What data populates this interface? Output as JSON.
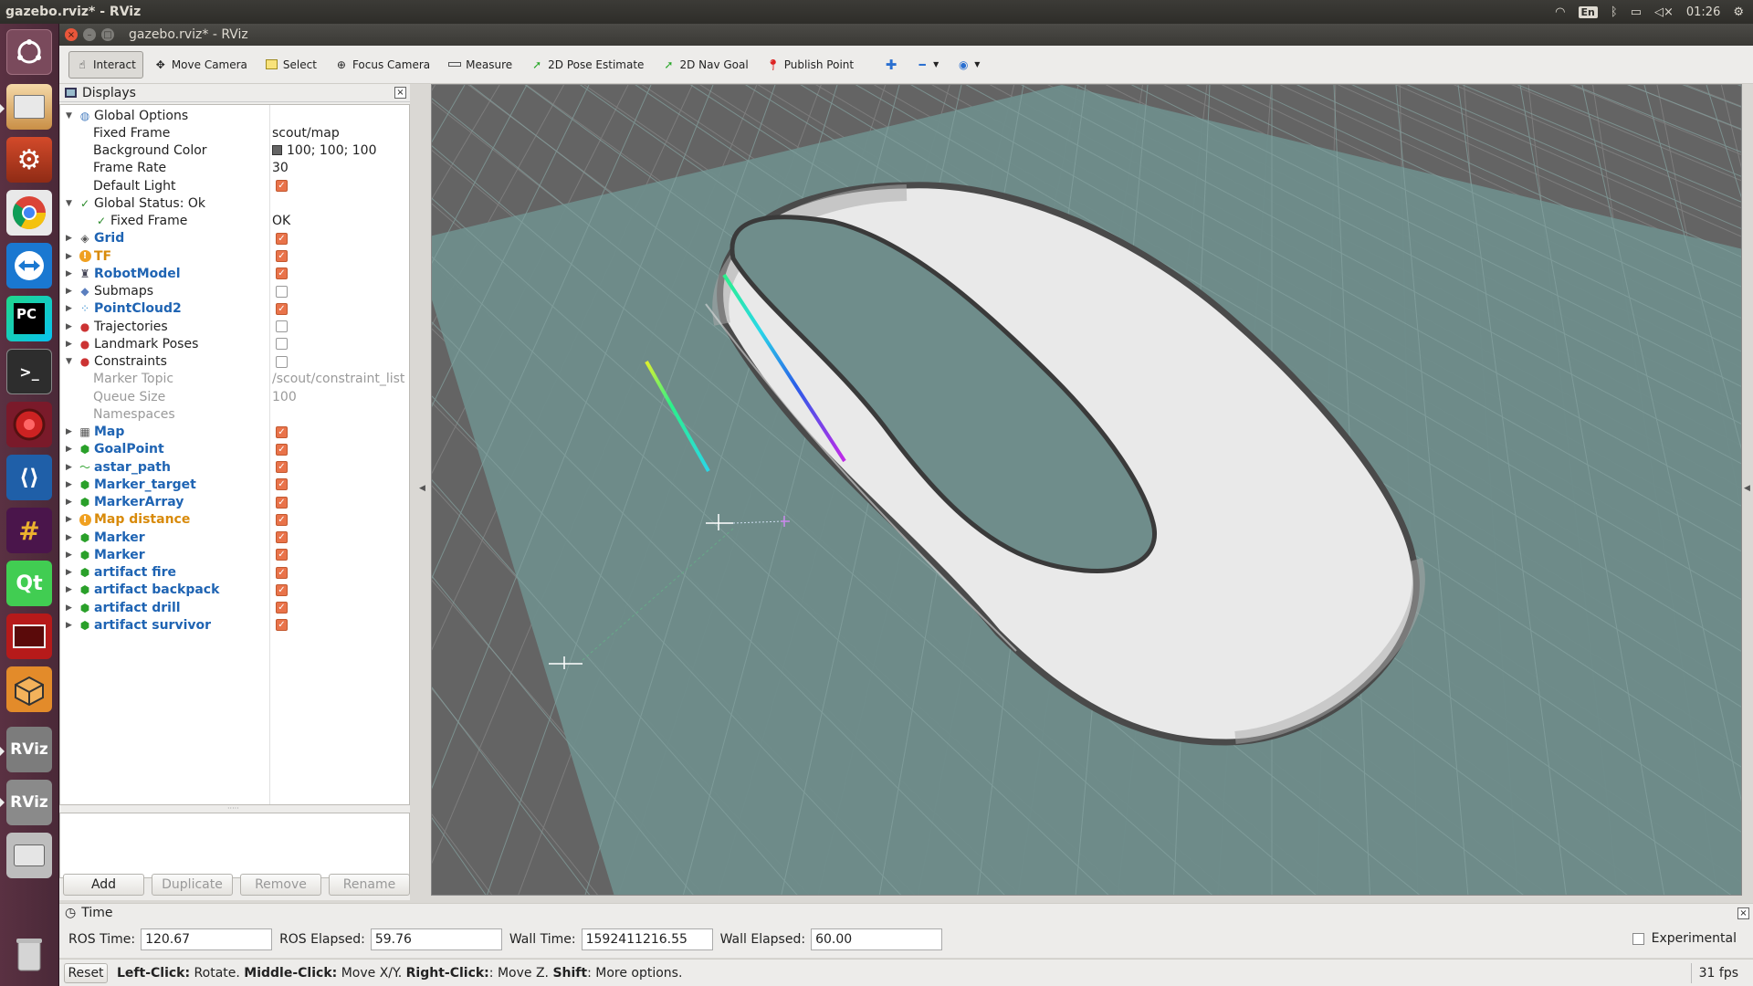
{
  "topbar": {
    "title": "gazebo.rviz* - RViz",
    "clock": "01:26",
    "lang": "En"
  },
  "window": {
    "title": "gazebo.rviz* - RViz"
  },
  "launcher": {
    "items": [
      "dash",
      "files",
      "settings",
      "chrome",
      "teamviewer",
      "pycharm",
      "terminal",
      "recorder",
      "vscode",
      "slack",
      "qt",
      "dashboard",
      "3d-box",
      "rviz",
      "rviz",
      "disk",
      "trash"
    ],
    "rviz_label": "RViz",
    "qt_label": "Qt",
    "pc_label": "PC"
  },
  "toolbar": {
    "interact": "Interact",
    "move_camera": "Move Camera",
    "select": "Select",
    "focus_camera": "Focus Camera",
    "measure": "Measure",
    "pose_estimate": "2D Pose Estimate",
    "nav_goal": "2D Nav Goal",
    "publish_point": "Publish Point"
  },
  "displays": {
    "title": "Displays",
    "rows": [
      {
        "name": "Global Options",
        "value": ""
      },
      {
        "name": "Fixed Frame",
        "value": "scout/map"
      },
      {
        "name": "Background Color",
        "value": "100; 100; 100"
      },
      {
        "name": "Frame Rate",
        "value": "30"
      },
      {
        "name": "Default Light",
        "value": ""
      },
      {
        "name": "Global Status: Ok",
        "value": ""
      },
      {
        "name": "Fixed Frame",
        "value": "OK"
      },
      {
        "name": "Grid",
        "value": ""
      },
      {
        "name": "TF",
        "value": ""
      },
      {
        "name": "RobotModel",
        "value": ""
      },
      {
        "name": "Submaps",
        "value": ""
      },
      {
        "name": "PointCloud2",
        "value": ""
      },
      {
        "name": "Trajectories",
        "value": ""
      },
      {
        "name": "Landmark Poses",
        "value": ""
      },
      {
        "name": "Constraints",
        "value": ""
      },
      {
        "name": "Marker Topic",
        "value": "/scout/constraint_list"
      },
      {
        "name": "Queue Size",
        "value": "100"
      },
      {
        "name": "Namespaces",
        "value": ""
      },
      {
        "name": "Map",
        "value": ""
      },
      {
        "name": "GoalPoint",
        "value": ""
      },
      {
        "name": "astar_path",
        "value": ""
      },
      {
        "name": "Marker_target",
        "value": ""
      },
      {
        "name": "MarkerArray",
        "value": ""
      },
      {
        "name": "Map distance",
        "value": ""
      },
      {
        "name": "Marker",
        "value": ""
      },
      {
        "name": "Marker",
        "value": ""
      },
      {
        "name": "artifact fire",
        "value": ""
      },
      {
        "name": "artifact backpack",
        "value": ""
      },
      {
        "name": "artifact drill",
        "value": ""
      },
      {
        "name": "artifact survivor",
        "value": ""
      }
    ],
    "buttons": {
      "add": "Add",
      "duplicate": "Duplicate",
      "remove": "Remove",
      "rename": "Rename"
    },
    "bg_color": "#646464"
  },
  "time": {
    "title": "Time",
    "ros_time_label": "ROS Time:",
    "ros_time": "120.67",
    "ros_elapsed_label": "ROS Elapsed:",
    "ros_elapsed": "59.76",
    "wall_time_label": "Wall Time:",
    "wall_time": "1592411216.55",
    "wall_elapsed_label": "Wall Elapsed:",
    "wall_elapsed": "60.00",
    "experimental": "Experimental"
  },
  "status": {
    "reset": "Reset",
    "hint_left": "Left-Click:",
    "hint_left_t": " Rotate. ",
    "hint_mid": "Middle-Click:",
    "hint_mid_t": " Move X/Y. ",
    "hint_right": "Right-Click:",
    "hint_right_t": ": Move Z. ",
    "hint_shift": "Shift",
    "hint_shift_t": ": More options.",
    "fps": "31 fps"
  },
  "colors": {
    "accent_check": "#e9734a",
    "display_blue": "#1f64b3",
    "warn_orange": "#d88a0a",
    "viewport_bg": "#646464",
    "map_plane": "#6f8d8b"
  }
}
